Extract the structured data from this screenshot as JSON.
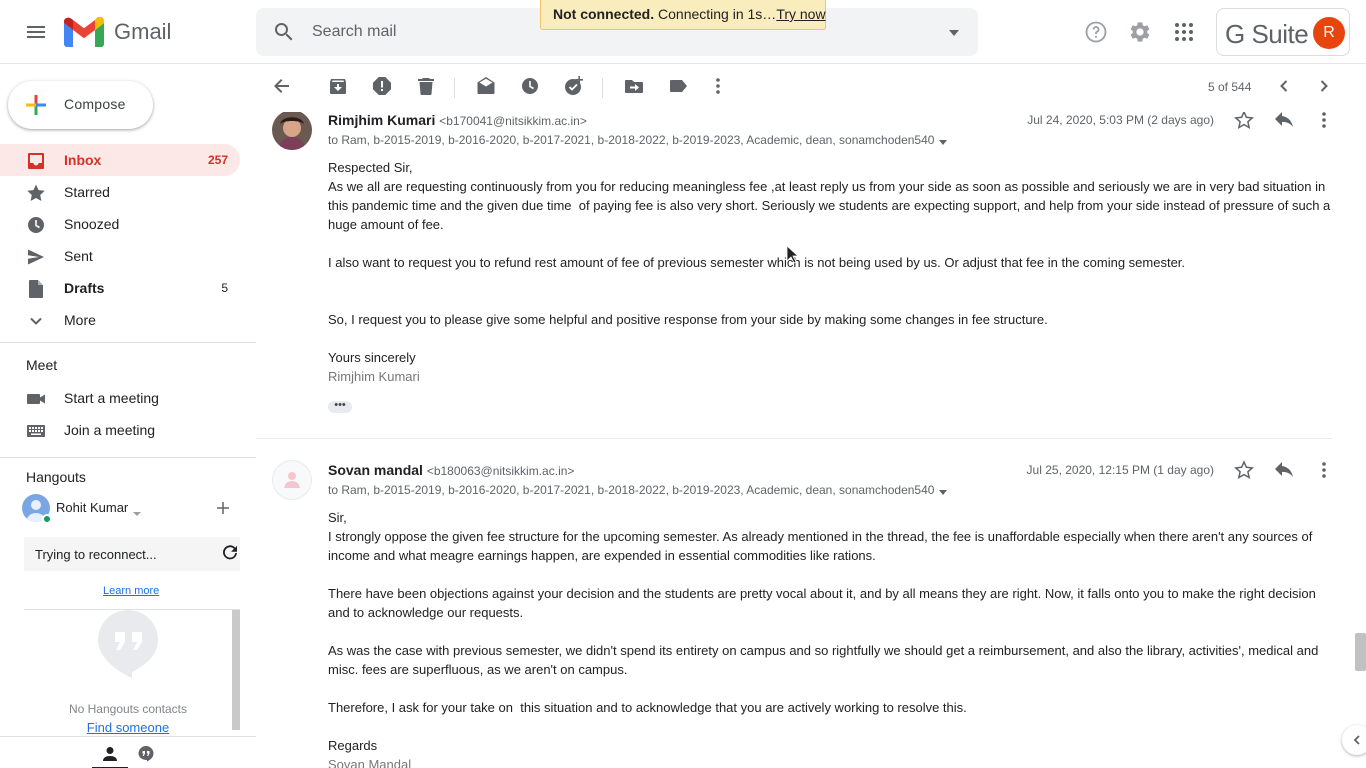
{
  "header": {
    "app_name": "Gmail",
    "search_placeholder": "Search mail",
    "notice_bold": "Not connected.",
    "notice_text": " Connecting in 1s…",
    "notice_link": "Try now",
    "gsuite_label": "G Suite",
    "avatar_letter": "R",
    "avatar_color": "#e8450e"
  },
  "sidebar": {
    "compose_label": "Compose",
    "items": [
      {
        "label": "Inbox",
        "count": "257",
        "icon": "inbox-icon"
      },
      {
        "label": "Starred",
        "count": "",
        "icon": "star-icon"
      },
      {
        "label": "Snoozed",
        "count": "",
        "icon": "clock-icon"
      },
      {
        "label": "Sent",
        "count": "",
        "icon": "send-icon"
      },
      {
        "label": "Drafts",
        "count": "5",
        "icon": "draft-icon"
      },
      {
        "label": "More",
        "count": "",
        "icon": "chevron-down-icon"
      }
    ],
    "meet": {
      "title": "Meet",
      "items": [
        {
          "label": "Start a meeting",
          "icon": "video-icon"
        },
        {
          "label": "Join a meeting",
          "icon": "keyboard-icon"
        }
      ]
    },
    "hangouts": {
      "title": "Hangouts",
      "user_name": "Rohit Kumar",
      "reconnect_text": "Trying to reconnect...",
      "learn_more": "Learn more",
      "empty_text": "No Hangouts contacts",
      "find_someone": "Find someone"
    }
  },
  "toolbar": {
    "pager": "5 of 544"
  },
  "messages": [
    {
      "sender_name": "Rimjhim Kumari",
      "sender_email": "<b170041@nitsikkim.ac.in>",
      "date": "Jul 24, 2020, 5:03 PM (2 days ago)",
      "recipients": "to Ram, b-2015-2019, b-2016-2020, b-2017-2021, b-2018-2022, b-2019-2023, Academic, dean, sonamchoden540",
      "body": [
        "Respected Sir,",
        "As we all are requesting continuously from you for reducing meaningless fee ,at least reply us from your side as soon as possible and seriously we are in very bad situation in this pandemic time and the given due time  of paying fee is also very short. Seriously we students are expecting support, and help from your side instead of pressure of such a huge amount of fee.",
        "",
        "I also want to request you to refund rest amount of fee of previous semester which is not being used by us. Or adjust that fee in the coming semester.",
        "",
        "",
        "So, I request you to please give some helpful and positive response from your side by making some changes in fee structure.",
        "",
        "Yours sincerely"
      ],
      "signature": "Rimjhim Kumari",
      "ellipsis": "•••"
    },
    {
      "sender_name": "Sovan mandal",
      "sender_email": "<b180063@nitsikkim.ac.in>",
      "date": "Jul 25, 2020, 12:15 PM (1 day ago)",
      "recipients": "to Ram, b-2015-2019, b-2016-2020, b-2017-2021, b-2018-2022, b-2019-2023, Academic, dean, sonamchoden540",
      "body": [
        "Sir,",
        "I strongly oppose the given fee structure for the upcoming semester. As already mentioned in the thread, the fee is unaffordable especially when there aren't any sources of income and what meagre earnings happen, are expended in essential commodities like rations.",
        "",
        "There have been objections against your decision and the students are pretty vocal about it, and by all means they are right. Now, it falls onto you to make the right decision and to acknowledge our requests.",
        "",
        "As was the case with previous semester, we didn't spend its entirety on campus and so rightfully we should get a reimbursement, and also the library, activities', medical and misc. fees are superfluous, as we aren't on campus.",
        "",
        "Therefore, I ask for your take on  this situation and to acknowledge that you are actively working to resolve this.",
        "",
        "Regards"
      ],
      "signature": "Sovan Mandal"
    }
  ]
}
